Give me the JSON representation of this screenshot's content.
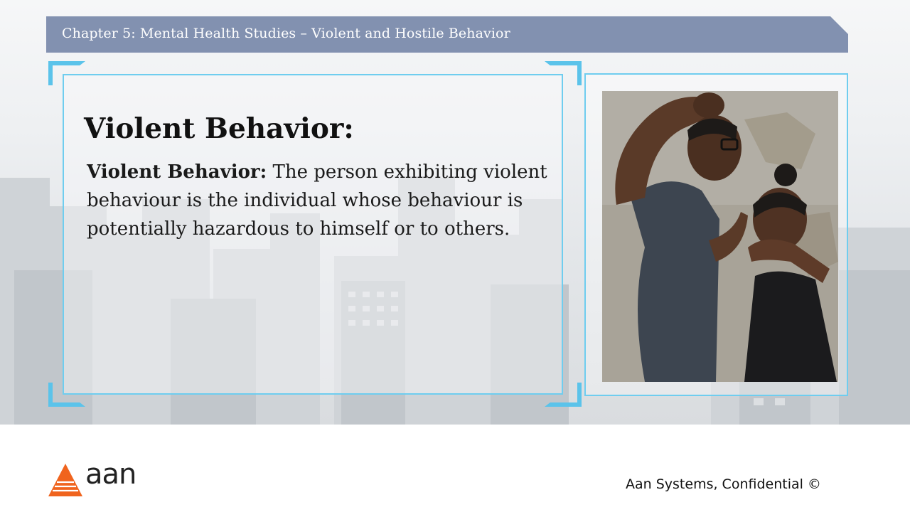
{
  "header": {
    "title": "Chapter 5: Mental Health Studies – Violent and Hostile Behavior"
  },
  "content": {
    "heading": "Violent Behavior:",
    "definition_term": "Violent Behavior:",
    "definition_text": " The person exhibiting violent behaviour is the individual whose behaviour is potentially hazardous to himself or to others."
  },
  "footer": {
    "brand": "aan",
    "confidential": "Aan Systems, Confidential ©"
  },
  "icons": {
    "logo": "orange-triangle-logo-icon",
    "photo": "violent-confrontation-photo"
  },
  "colors": {
    "header_bar": "#8291b0",
    "frame_accent": "#6fcdef",
    "logo_orange": "#f0641e"
  }
}
